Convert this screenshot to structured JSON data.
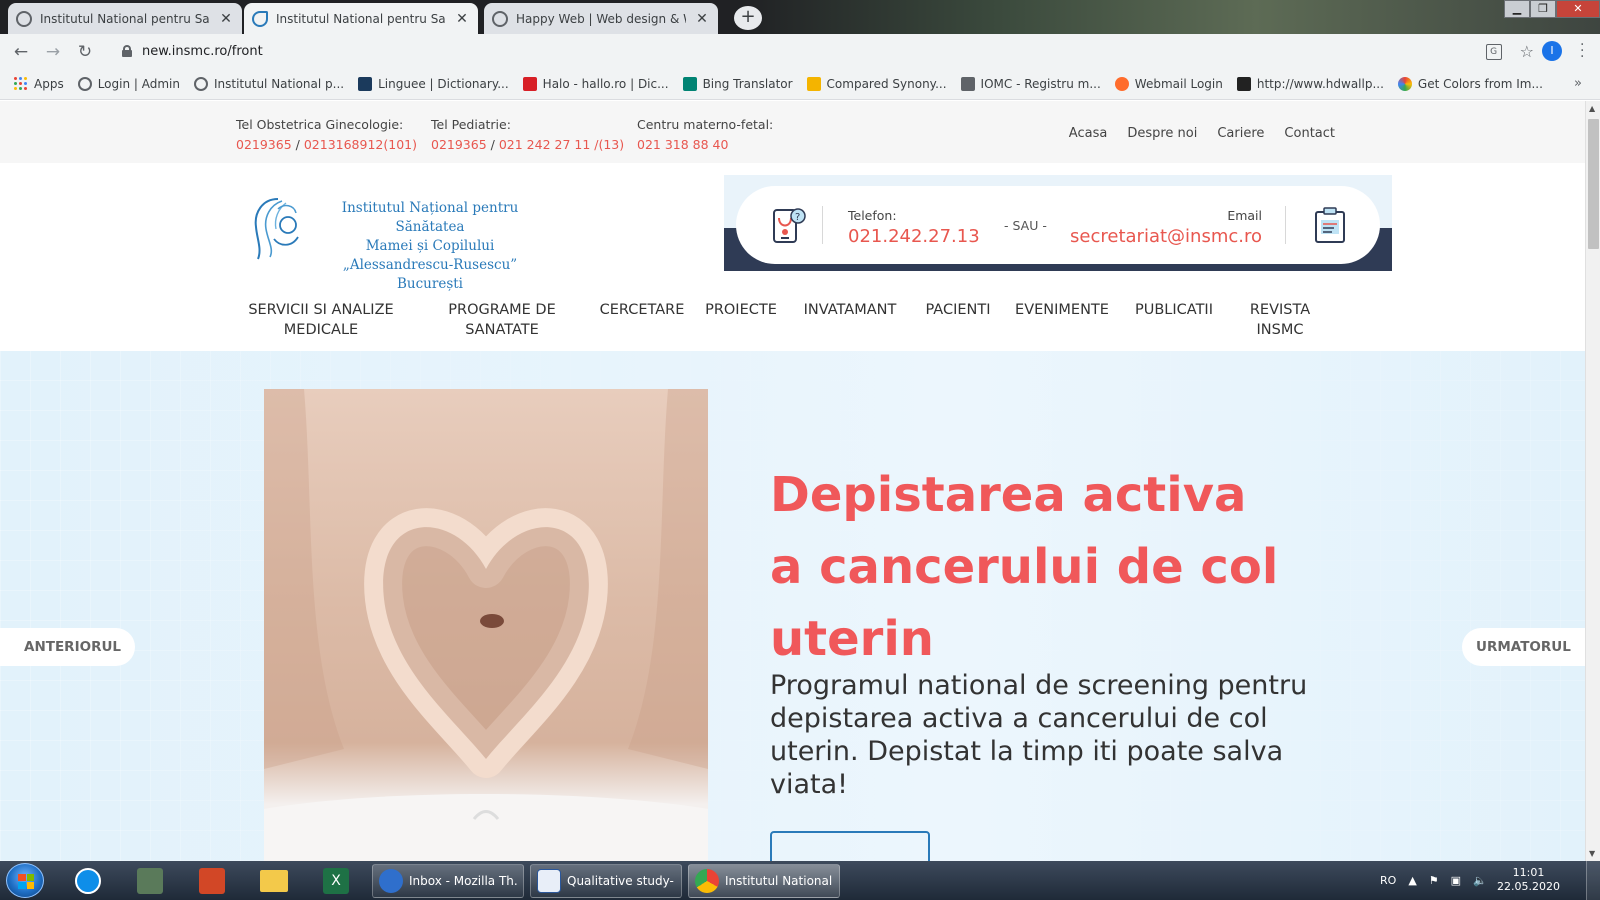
{
  "browser": {
    "tabs": [
      {
        "title": "Institutul National pentru Sanatatea"
      },
      {
        "title": "Institutul National pentru Sanatatea"
      },
      {
        "title": "Happy Web | Web design & Web"
      }
    ],
    "url": "new.insmc.ro/front",
    "profile_initial": "I",
    "bookmarks": [
      "Apps",
      "Login | Admin",
      "Institutul National p...",
      "Linguee | Dictionary...",
      "Halo - hallo.ro | Dic...",
      "Bing Translator",
      "Compared Synony...",
      "IOMC - Registru m...",
      "Webmail Login",
      "http://www.hdwallp...",
      "Get Colors from Im..."
    ]
  },
  "site": {
    "topbar": {
      "col1": {
        "label": "Tel Obstetrica Ginecologie:",
        "phone1": "0219365",
        "sep": " / ",
        "phone2": "0213168912(101)"
      },
      "col2": {
        "label": "Tel Pediatrie:",
        "phone1": "0219365",
        "sep": " / ",
        "phone2": "021 242 27 11 /(13)"
      },
      "col3": {
        "label": "Centru materno-fetal:",
        "phone1": "021 318 88 40"
      },
      "nav": [
        "Acasa",
        "Despre noi",
        "Cariere",
        "Contact"
      ]
    },
    "logo": {
      "line1": "Institutul Național pentru Sănătatea",
      "line2": "Mamei și Copilului",
      "line3": "„Alessandrescu-Rusescu” București"
    },
    "callbox": {
      "phone_label": "Telefon:",
      "phone_value": "021.242.27.13",
      "or_text": "- SAU -",
      "email_label": "Email",
      "email_value": "secretariat@insmc.ro"
    },
    "mainnav": [
      {
        "line1": "SERVICII SI ANALIZE",
        "line2": "MEDICALE"
      },
      {
        "line1": "PROGRAME DE",
        "line2": "SANATATE"
      },
      {
        "line1": "CERCETARE",
        "line2": ""
      },
      {
        "line1": "PROIECTE",
        "line2": ""
      },
      {
        "line1": "INVATAMANT",
        "line2": ""
      },
      {
        "line1": "PACIENTI",
        "line2": ""
      },
      {
        "line1": "EVENIMENTE",
        "line2": ""
      },
      {
        "line1": "PUBLICATII",
        "line2": ""
      },
      {
        "line1": "REVISTA",
        "line2": "INSMC"
      }
    ],
    "hero": {
      "title": "Depistarea activa a cancerului de col uterin",
      "subtitle": "Programul national de screening pentru depistarea activa a cancerului de col uterin. Depistat la timp iti poate salva viata!",
      "prev_label": "ANTERIORUL",
      "next_label": "URMATORUL"
    },
    "colors": {
      "accent_red": "#f0585a",
      "brand_blue": "#2a7ab9",
      "navy": "#2f3b55"
    }
  },
  "taskbar": {
    "tasks": [
      {
        "label": "Inbox - Mozilla Th..."
      },
      {
        "label": "Qualitative study-..."
      },
      {
        "label": "Institutul National..."
      }
    ],
    "lang": "RO",
    "time": "11:01",
    "date": "22.05.2020"
  }
}
